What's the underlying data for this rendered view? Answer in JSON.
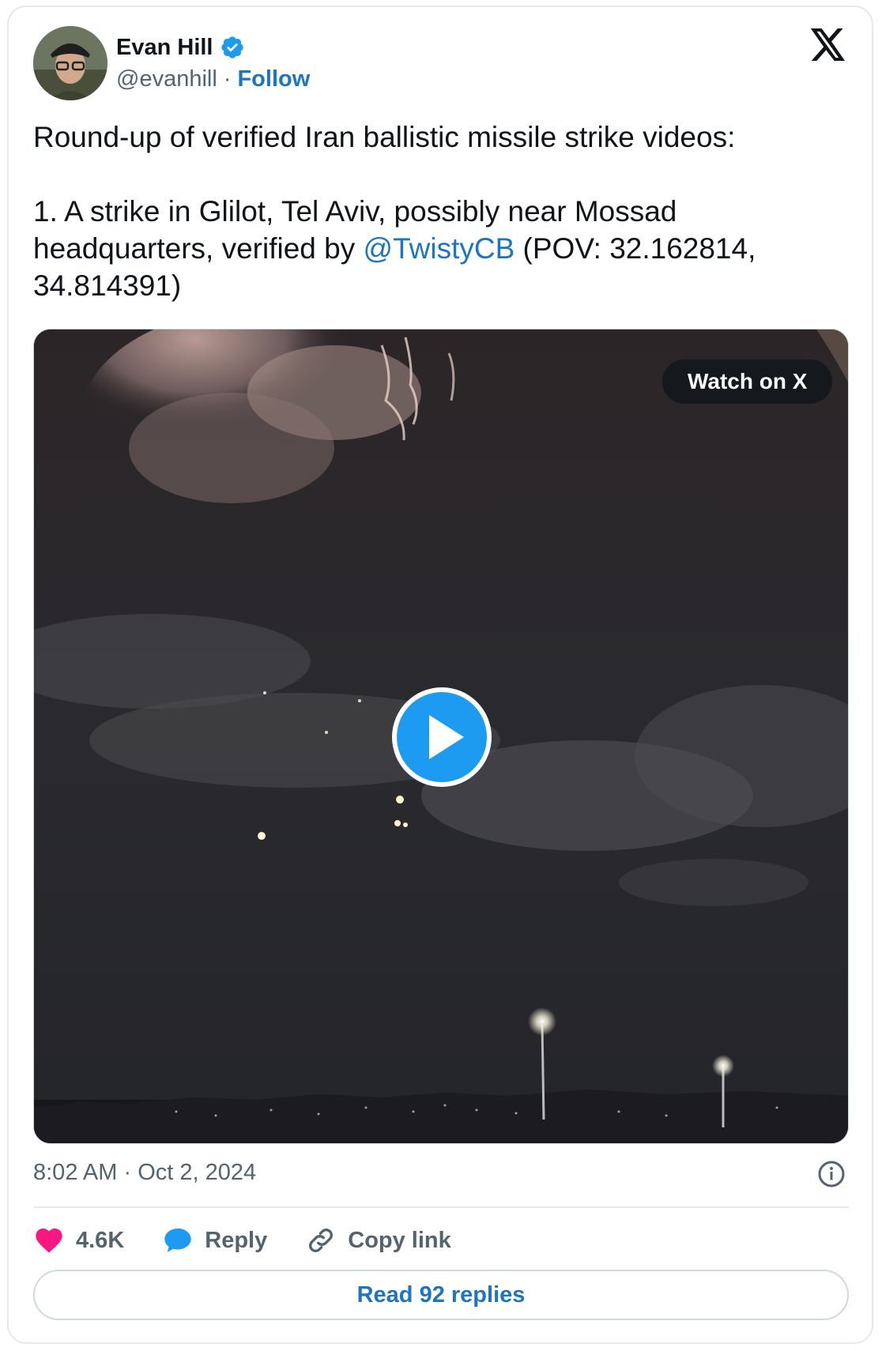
{
  "author": {
    "name": "Evan Hill",
    "handle": "@evanhill",
    "separator": "·",
    "follow_label": "Follow",
    "verified_icon": "verified-badge-icon"
  },
  "tweet": {
    "line1": "Round-up of verified Iran ballistic missile strike videos:",
    "line2_prefix": "1. A strike in Glilot, Tel Aviv, possibly near Mossad headquarters, verified by ",
    "mention": "@TwistyCB",
    "line2_suffix": " (POV: 32.162814, 34.814391)"
  },
  "media": {
    "watch_label": "Watch on X",
    "play_icon": "play-icon"
  },
  "meta": {
    "time": "8:02 AM",
    "separator": " · ",
    "date": "Oct 2, 2024"
  },
  "actions": {
    "likes": "4.6K",
    "reply_label": "Reply",
    "copy_label": "Copy link"
  },
  "read_replies_label": "Read 92 replies",
  "colors": {
    "link": "#1d75bf",
    "heart": "#f91880",
    "reply_bubble": "#1d9bf0",
    "muted": "#536471"
  }
}
